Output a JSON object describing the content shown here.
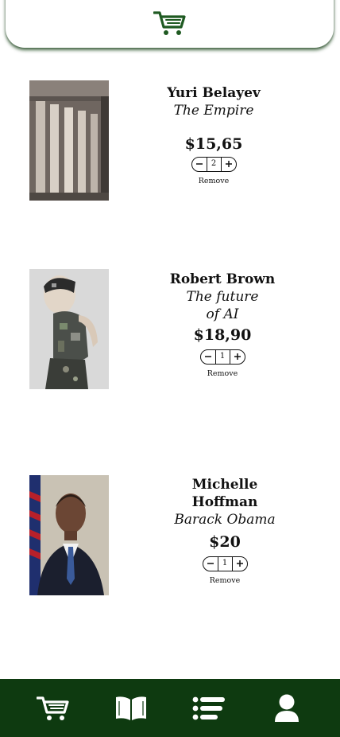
{
  "header": {
    "icon": "cart-icon"
  },
  "cart": {
    "items": [
      {
        "author": "Yuri Belayev",
        "title": "The Empire",
        "price": "$15,65",
        "quantity": "2",
        "remove_label": "Remove",
        "image": "classical-columns-photo"
      },
      {
        "author": "Robert Brown",
        "title": "The future of AI",
        "price": "$18,90",
        "quantity": "1",
        "remove_label": "Remove",
        "image": "humanoid-robot-photo"
      },
      {
        "author": "Michelle Hoffman",
        "title": "Barack Obama",
        "price": "$20",
        "quantity": "1",
        "remove_label": "Remove",
        "image": "portrait-photo"
      }
    ]
  },
  "nav": {
    "items": [
      {
        "icon": "cart-icon",
        "label": "cart"
      },
      {
        "icon": "book-icon",
        "label": "library"
      },
      {
        "icon": "list-icon",
        "label": "list"
      },
      {
        "icon": "user-icon",
        "label": "profile"
      }
    ]
  },
  "colors": {
    "nav_background": "#0e3a10",
    "accent": "#1f5a22"
  }
}
